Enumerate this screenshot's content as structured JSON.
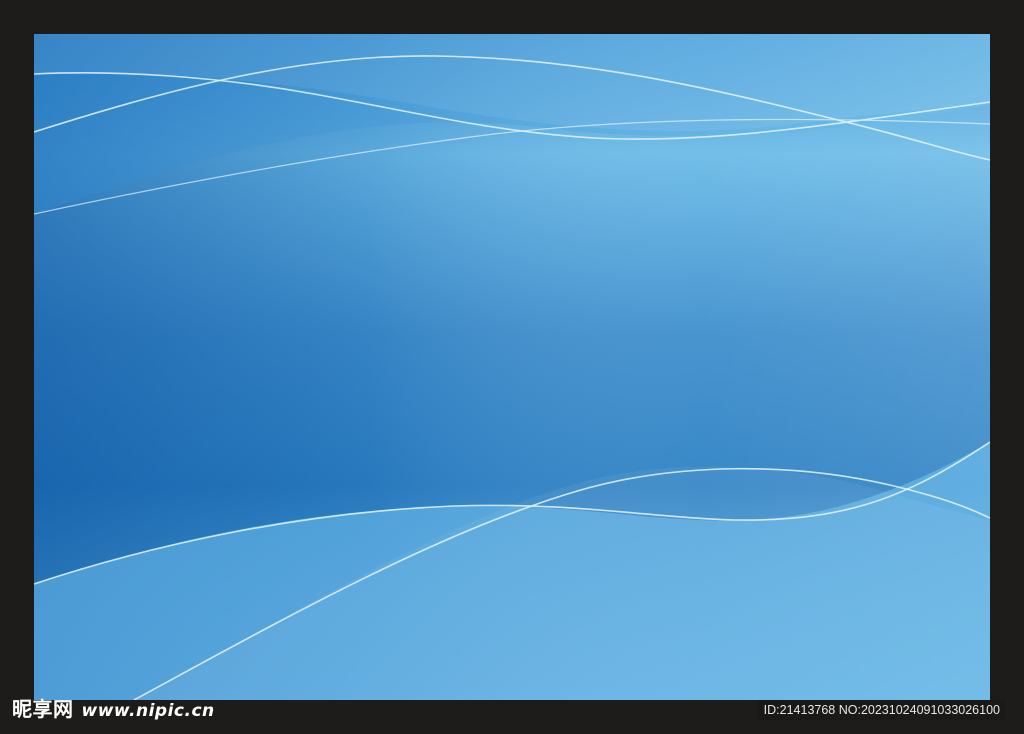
{
  "colors": {
    "frame": "#1d1c1a",
    "sky_light": "#6dbdea",
    "sky_mid": "#3f90cf",
    "sky_dark": "#1e6cb3",
    "line": "#e6f4fc"
  },
  "watermark": {
    "site_cn": "昵享网",
    "site_url": "www.nipic.cn"
  },
  "image_id_text": "ID:21413768 NO:20231024091033026100"
}
